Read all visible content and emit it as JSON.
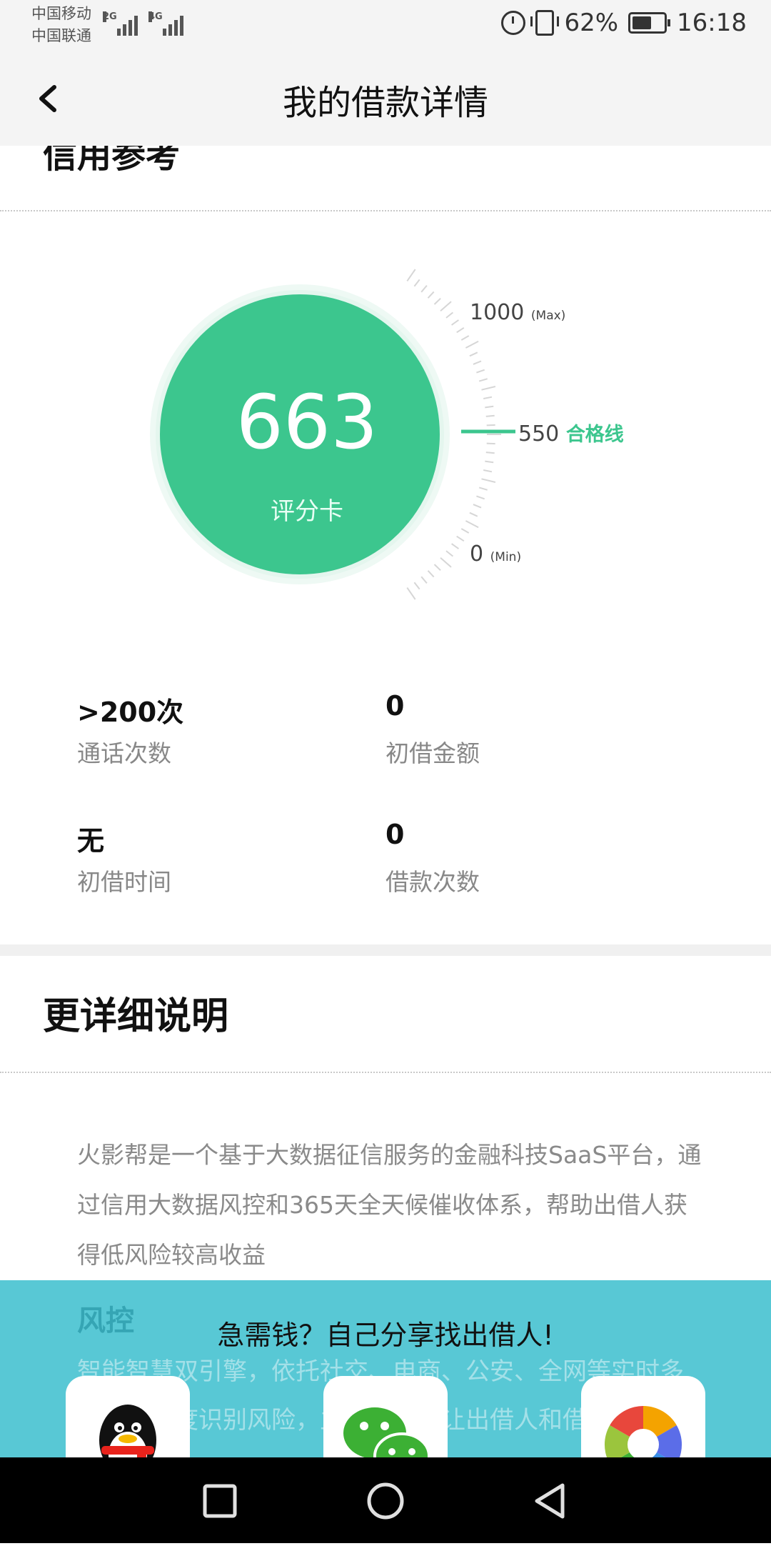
{
  "status_bar": {
    "carrier_1": "中国移动",
    "carrier_2": "中国联通",
    "net_1": "2G",
    "net_2": "4G",
    "battery_pct": "62%",
    "battery_level": 0.62,
    "time": "16:18"
  },
  "header": {
    "title": "我的借款详情"
  },
  "credit_section": {
    "title": "信用参考"
  },
  "gauge": {
    "score": "663",
    "score_label": "评分卡",
    "max_value": "1000",
    "max_tag": "(Max)",
    "pass_value": "550",
    "pass_tag": "合格线",
    "min_value": "0",
    "min_tag": "(Min)"
  },
  "stats": [
    {
      "value": ">200次",
      "label": "通话次数"
    },
    {
      "value": "0",
      "label": "初借金额"
    },
    {
      "value": "无",
      "label": "初借时间"
    },
    {
      "value": "0",
      "label": "借款次数"
    }
  ],
  "details": {
    "title": "更详细说明",
    "paragraph": "火影帮是一个基于大数据征信服务的金融科技SaaS平台，通过信用大数据风控和365天全天候催收体系，帮助出借人获得低风险较高收益",
    "sub_title": "风控",
    "sub_paragraph": "智能智慧双引擎，依托社交、电商、公安、全网等实时多层次多维度识别风险，主流信用，让出借人和借款人更有保障"
  },
  "share": {
    "title": "急需钱？自己分享找出借人!",
    "targets": [
      {
        "icon": "qq-icon"
      },
      {
        "icon": "wechat-icon"
      },
      {
        "icon": "moments-icon"
      }
    ]
  },
  "colors": {
    "accent": "#3cc68e",
    "share_bg": "#58c8d5",
    "header_bg": "#f4f4f4"
  }
}
